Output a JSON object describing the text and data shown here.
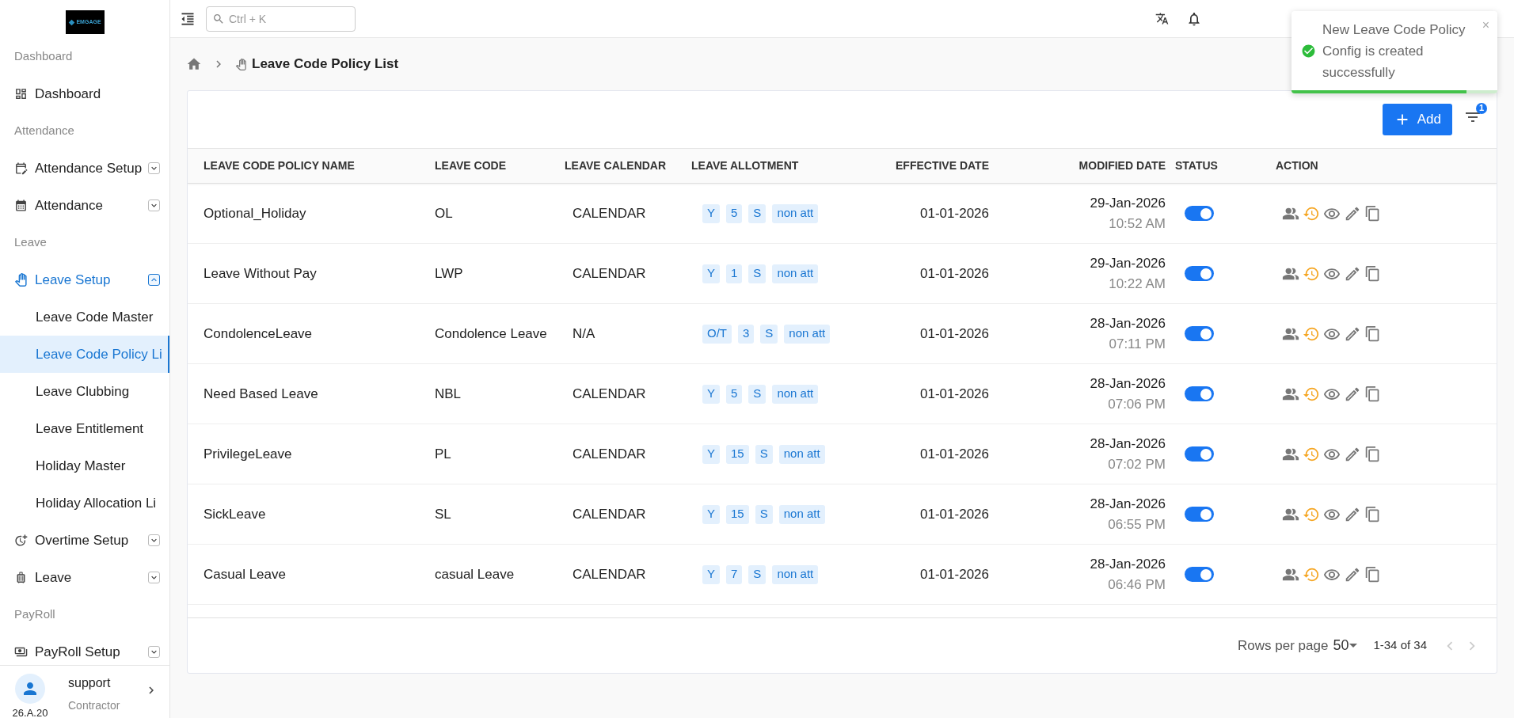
{
  "sidebar": {
    "logo_text": "EMGAGE",
    "sections": [
      {
        "title": "Dashboard",
        "items": [
          {
            "label": "Dashboard",
            "selected": false
          }
        ]
      },
      {
        "title": "Attendance",
        "items": [
          {
            "label": "Attendance Setup",
            "expanded": false,
            "selected": false
          },
          {
            "label": "Attendance",
            "expanded": false,
            "selected": false
          }
        ]
      },
      {
        "title": "Leave",
        "items": [
          {
            "label": "Leave Setup",
            "expanded": true,
            "selected": true,
            "children": [
              {
                "label": "Leave Code Master",
                "selected": false
              },
              {
                "label": "Leave Code Policy Li",
                "selected": true
              },
              {
                "label": "Leave Clubbing",
                "selected": false
              },
              {
                "label": "Leave Entitlement",
                "selected": false
              },
              {
                "label": "Holiday Master",
                "selected": false
              },
              {
                "label": "Holiday Allocation Li",
                "selected": false
              }
            ]
          },
          {
            "label": "Overtime Setup",
            "expanded": false,
            "selected": false
          },
          {
            "label": "Leave",
            "expanded": false,
            "selected": false
          }
        ]
      },
      {
        "title": "PayRoll",
        "items": [
          {
            "label": "PayRoll Setup",
            "expanded": false,
            "selected": false
          }
        ]
      }
    ],
    "user": {
      "name": "support",
      "role": "Contractor",
      "version": "26.A.20"
    }
  },
  "topbar": {
    "search": {
      "placeholder": "Ctrl + K"
    }
  },
  "toast": {
    "message": "New Leave Code Policy Config is created successfully",
    "close": "×",
    "level": 0.85
  },
  "breadcrumb": {
    "current": "Leave Code Policy List"
  },
  "toolbar": {
    "add_button": "Add",
    "filter_badge": "1"
  },
  "table": {
    "columns": [
      "LEAVE CODE POLICY NAME",
      "LEAVE CODE",
      "LEAVE CALENDAR",
      "LEAVE ALLOTMENT",
      "EFFECTIVE DATE",
      "MODIFIED DATE",
      "STATUS",
      "ACTION"
    ],
    "rows": [
      {
        "name": "Optional_Holiday",
        "code": "OL",
        "calendar": "CALENDAR",
        "allotment": [
          "Y",
          "5",
          "S",
          "non att"
        ],
        "effective": "01-01-2026",
        "modified_date": "29-Jan-2026",
        "modified_time": "10:52 AM",
        "status_on": true
      },
      {
        "name": "Leave Without Pay",
        "code": "LWP",
        "calendar": "CALENDAR",
        "allotment": [
          "Y",
          "1",
          "S",
          "non att"
        ],
        "effective": "01-01-2026",
        "modified_date": "29-Jan-2026",
        "modified_time": "10:22 AM",
        "status_on": true
      },
      {
        "name": "CondolenceLeave",
        "code": "Condolence Leave",
        "calendar": "N/A",
        "allotment": [
          "O/T",
          "3",
          "S",
          "non att"
        ],
        "effective": "01-01-2026",
        "modified_date": "28-Jan-2026",
        "modified_time": "07:11 PM",
        "status_on": true
      },
      {
        "name": "Need Based Leave",
        "code": "NBL",
        "calendar": "CALENDAR",
        "allotment": [
          "Y",
          "5",
          "S",
          "non att"
        ],
        "effective": "01-01-2026",
        "modified_date": "28-Jan-2026",
        "modified_time": "07:06 PM",
        "status_on": true
      },
      {
        "name": "PrivilegeLeave",
        "code": "PL",
        "calendar": "CALENDAR",
        "allotment": [
          "Y",
          "15",
          "S",
          "non att"
        ],
        "effective": "01-01-2026",
        "modified_date": "28-Jan-2026",
        "modified_time": "07:02 PM",
        "status_on": true
      },
      {
        "name": "SickLeave",
        "code": "SL",
        "calendar": "CALENDAR",
        "allotment": [
          "Y",
          "15",
          "S",
          "non att"
        ],
        "effective": "01-01-2026",
        "modified_date": "28-Jan-2026",
        "modified_time": "06:55 PM",
        "status_on": true
      },
      {
        "name": "Casual Leave",
        "code": "casual Leave",
        "calendar": "CALENDAR",
        "allotment": [
          "Y",
          "7",
          "S",
          "non att"
        ],
        "effective": "01-01-2026",
        "modified_date": "28-Jan-2026",
        "modified_time": "06:46 PM",
        "status_on": true
      }
    ]
  },
  "pagination": {
    "rows_per_page_label": "Rows per page",
    "rows_per_page": "50",
    "range": "1-34 of 34",
    "prev_disabled": true,
    "next_disabled": true
  }
}
